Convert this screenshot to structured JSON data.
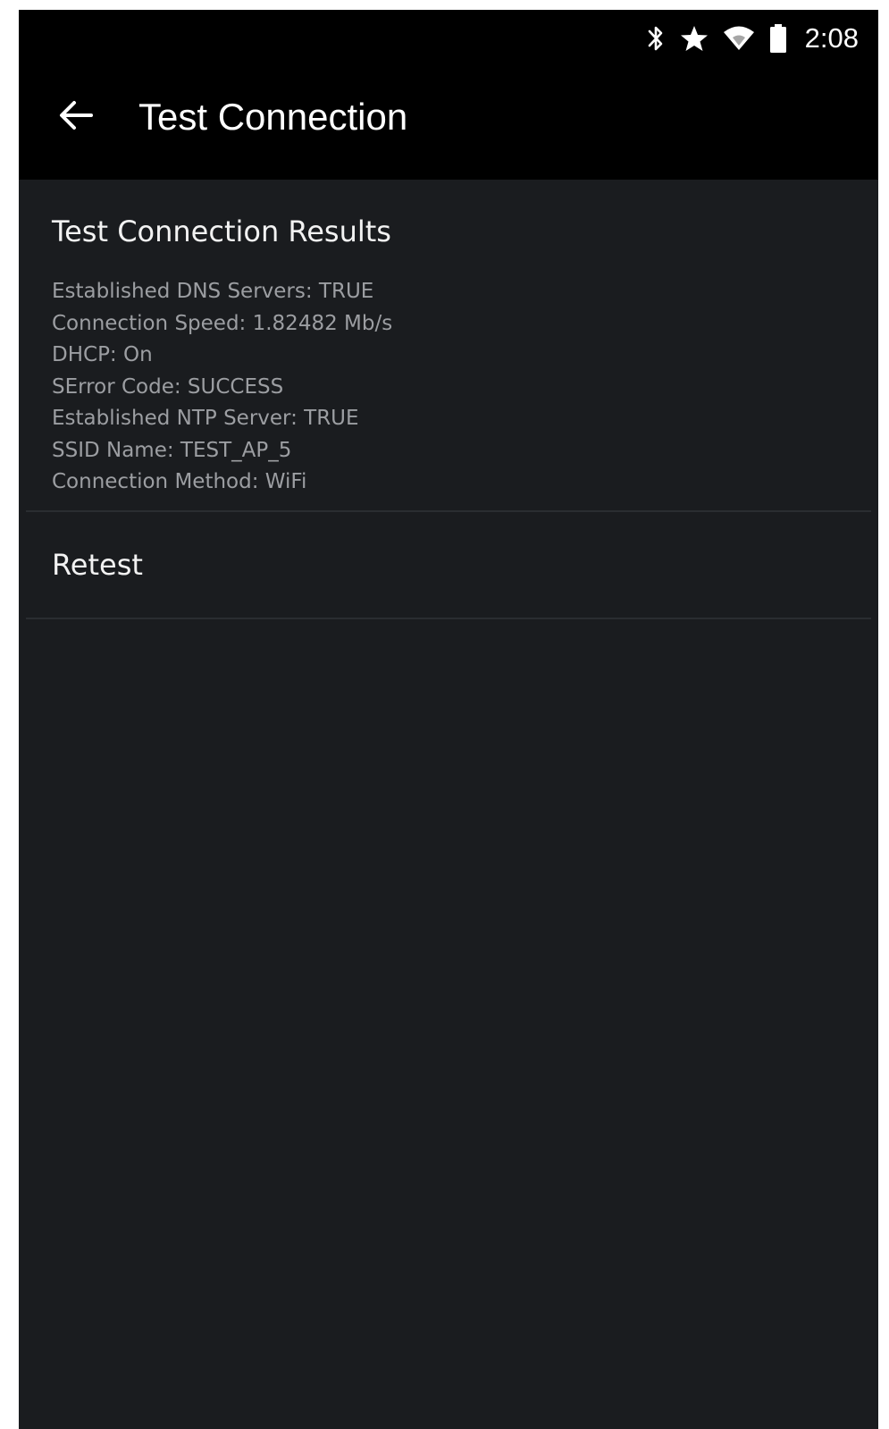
{
  "status_bar": {
    "icons": [
      "bluetooth-icon",
      "star-icon",
      "wifi-icon",
      "battery-icon"
    ],
    "time": "2:08"
  },
  "app_bar": {
    "back_icon": "arrow-back-icon",
    "title": "Test Connection"
  },
  "results": {
    "title": "Test Connection Results",
    "lines": [
      "Established DNS Servers: TRUE",
      "Connection Speed: 1.82482 Mb/s",
      "DHCP: On",
      "SError Code: SUCCESS",
      "Established NTP Server: TRUE",
      "SSID Name: TEST_AP_5",
      "Connection Method: WiFi"
    ]
  },
  "actions": {
    "retest_label": "Retest"
  },
  "colors": {
    "background": "#1a1c1f",
    "bars": "#000000",
    "primary_text": "#f2f2f2",
    "secondary_text": "#9c9ea2"
  }
}
